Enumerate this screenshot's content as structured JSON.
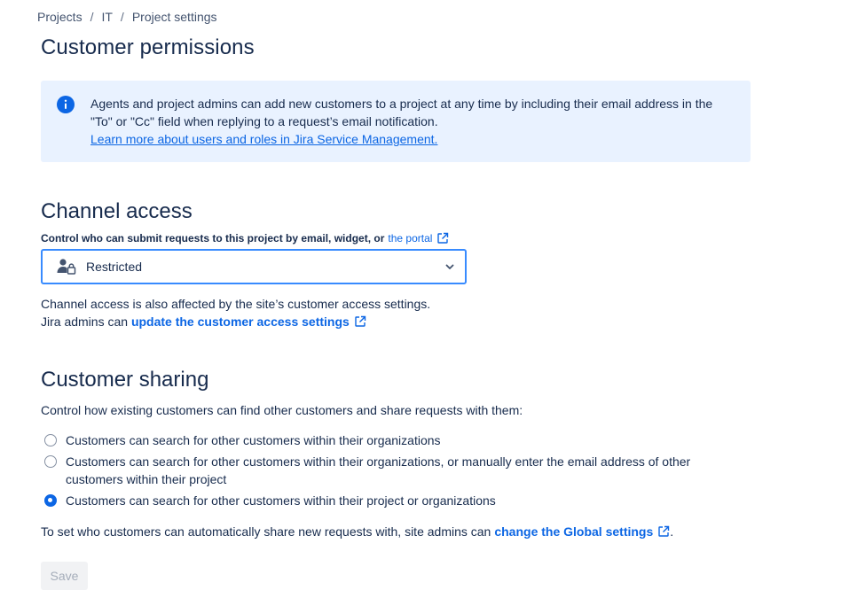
{
  "breadcrumb": {
    "items": [
      "Projects",
      "IT",
      "Project settings"
    ],
    "separator": "/"
  },
  "page_title": "Customer permissions",
  "info_panel": {
    "icon": "info-icon",
    "text_line1": "Agents and project admins can add new customers to a project at any time by including their email address in the",
    "text_line2": "\"To\" or \"Cc\" field when replying to a request’s email notification.",
    "link": "Learn more about users and roles in Jira Service Management."
  },
  "channel_access": {
    "title": "Channel access",
    "label": "Control who can submit requests to this project by email, widget, or",
    "label_link": "the portal",
    "select_value": "Restricted",
    "help_line1": "Channel access is also affected by the site’s customer access settings.",
    "help_line2_prefix": "Jira admins can",
    "help_link": "update the customer access settings"
  },
  "customer_sharing": {
    "title": "Customer sharing",
    "description": "Control how existing customers can find other customers and share requests with them:",
    "options": [
      {
        "label": "Customers can search for other customers within their organizations",
        "checked": false
      },
      {
        "label": "Customers can search for other customers within their organizations, or manually enter the email address of other customers within their project",
        "checked": false
      },
      {
        "label": "Customers can search for other customers within their project or organizations",
        "checked": true
      }
    ],
    "global_prefix": "To set who customers can automatically share new requests with, site admins can",
    "global_link": "change the Global settings",
    "global_suffix": "."
  },
  "save_label": "Save",
  "colors": {
    "accent": "#0c66e4",
    "info_bg": "#e9f2ff",
    "text": "#172b4d",
    "focus_border": "#388bff"
  }
}
